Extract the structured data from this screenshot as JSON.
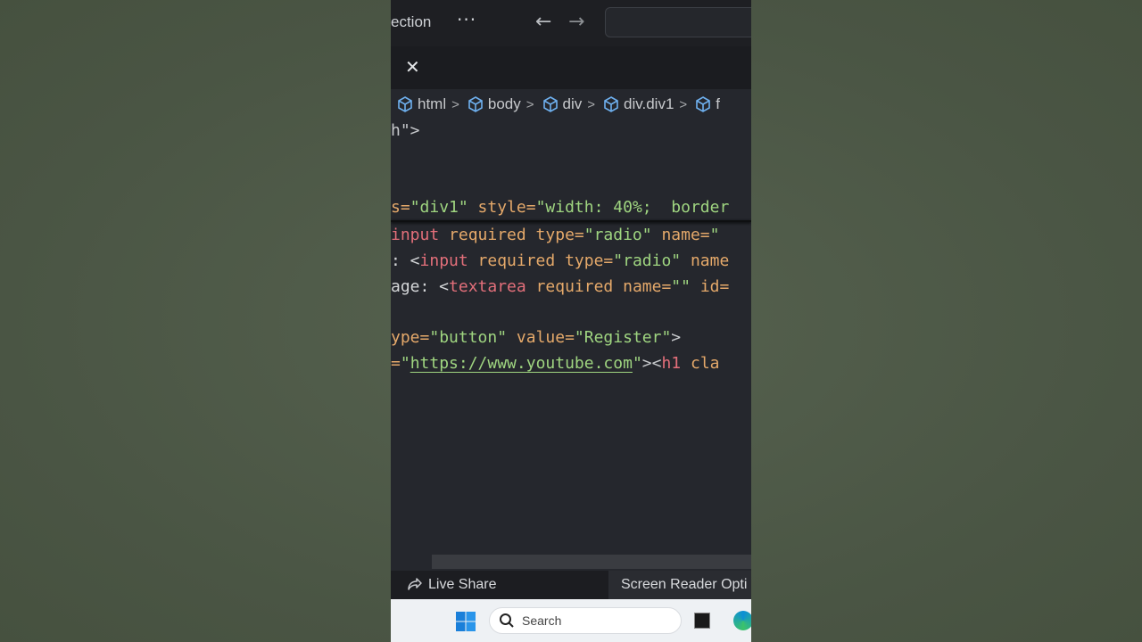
{
  "titlebar": {
    "menu_label": "ection",
    "more": "···",
    "back": "←",
    "forward": "→"
  },
  "tab": {
    "close": "✕"
  },
  "breadcrumb": [
    "html",
    "body",
    "div",
    "div.div1",
    "f"
  ],
  "code": {
    "l1": {
      "a": "h",
      "b": "\">"
    },
    "l2": {
      "a": "s=",
      "b": "\"div1\"",
      "c": " style=",
      "d": "\"width: 40%;  border"
    },
    "l3": {
      "a": "input",
      "b": " required type=",
      "c": "\"radio\"",
      "d": " name=",
      "e": "\""
    },
    "l4": {
      "a": ": <",
      "b": "input",
      "c": " required type=",
      "d": "\"radio\"",
      "e": " name"
    },
    "l5": {
      "a": "age: <",
      "b": "textarea",
      "c": " required name=",
      "d": "\"\"",
      "e": " id="
    },
    "l6": {
      "a": "ype=",
      "b": "\"button\"",
      "c": " value=",
      "d": "\"Register\"",
      "e": ">"
    },
    "l7": {
      "a": "=",
      "b": "\"",
      "c": "https://www.youtube.com",
      "d": "\"",
      "e": "><",
      "f": "h1",
      "g": " cla"
    }
  },
  "statusbar": {
    "live_share": "Live Share",
    "screen_reader": "Screen Reader Opti"
  },
  "taskbar": {
    "search_label": "Search"
  },
  "colors": {
    "string": "#9fd580",
    "attribute": "#e5a96a",
    "tag": "#e36f7a",
    "editor_bg": "#25272d"
  }
}
